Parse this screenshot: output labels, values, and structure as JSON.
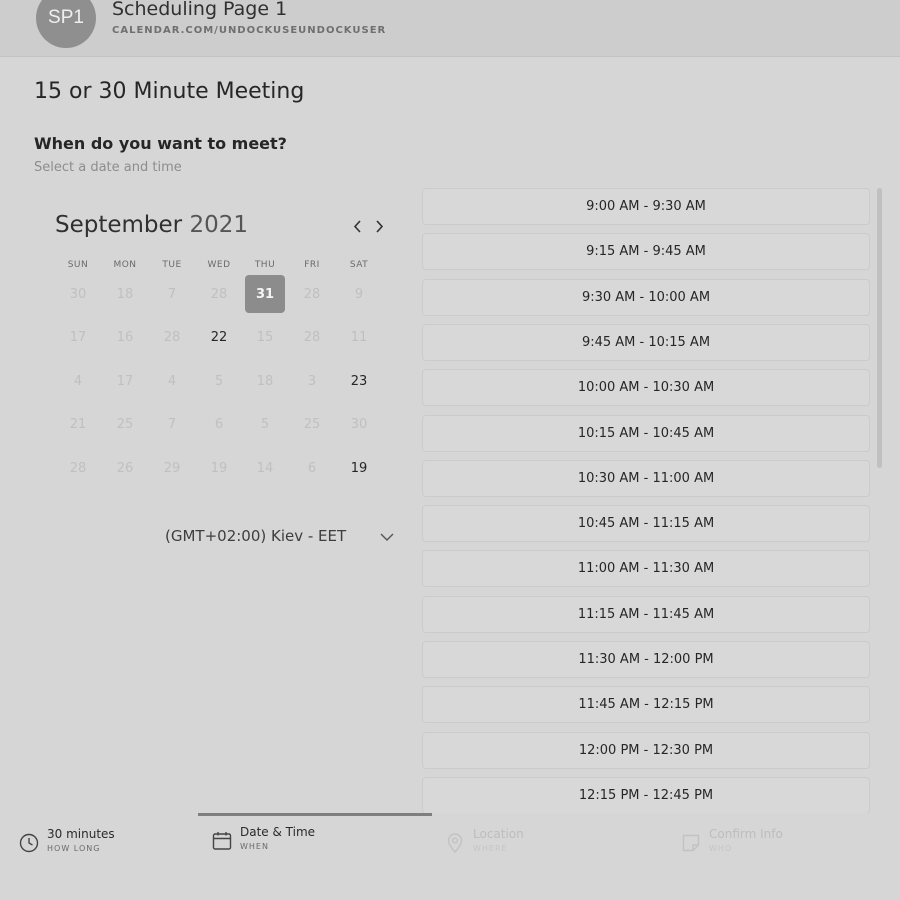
{
  "header": {
    "avatar_initials": "SP1",
    "page_name": "Scheduling Page 1",
    "page_url": "CALENDAR.COM/UNDOCKUSEUNDOCKUSER"
  },
  "meeting": {
    "title": "15 or 30 Minute Meeting",
    "question": "When do you want to meet?",
    "subtitle": "Select a date and time"
  },
  "calendar": {
    "month": "September",
    "year": "2021",
    "weekdays": [
      "SUN",
      "MON",
      "TUE",
      "WED",
      "THU",
      "FRI",
      "SAT"
    ],
    "weeks": [
      [
        "30",
        "18",
        "7",
        "28",
        "31",
        "28",
        "9"
      ],
      [
        "17",
        "16",
        "28",
        "22",
        "15",
        "28",
        "11"
      ],
      [
        "4",
        "17",
        "4",
        "5",
        "18",
        "3",
        "23"
      ],
      [
        "21",
        "25",
        "7",
        "6",
        "5",
        "25",
        "30"
      ],
      [
        "28",
        "26",
        "29",
        "19",
        "14",
        "6",
        "19"
      ]
    ],
    "available_days": [
      "22",
      "23",
      "19"
    ],
    "selected_day": "31"
  },
  "timezone": {
    "label": "(GMT+02:00) Kiev - EET"
  },
  "time_slots": [
    "9:00 AM - 9:30 AM",
    "9:15 AM - 9:45 AM",
    "9:30 AM - 10:00 AM",
    "9:45 AM - 10:15 AM",
    "10:00 AM - 10:30 AM",
    "10:15 AM - 10:45 AM",
    "10:30 AM - 11:00 AM",
    "10:45 AM - 11:15 AM",
    "11:00 AM - 11:30 AM",
    "11:15 AM - 11:45 AM",
    "11:30 AM - 12:00 PM",
    "11:45 AM - 12:15 PM",
    "12:00 PM - 12:30 PM",
    "12:15 PM - 12:45 PM"
  ],
  "steps": [
    {
      "label": "30 minutes",
      "caption": "HOW LONG",
      "icon": "clock-icon"
    },
    {
      "label": "Date & Time",
      "caption": "WHEN",
      "icon": "calendar-icon"
    },
    {
      "label": "Location",
      "caption": "WHERE",
      "icon": "location-pin-icon"
    },
    {
      "label": "Confirm Info",
      "caption": "WHO",
      "icon": "note-icon"
    }
  ],
  "colors": {
    "background": "#d6d6d6",
    "selected_day": "#8c8c8c",
    "progress": "#7f7f7f"
  }
}
